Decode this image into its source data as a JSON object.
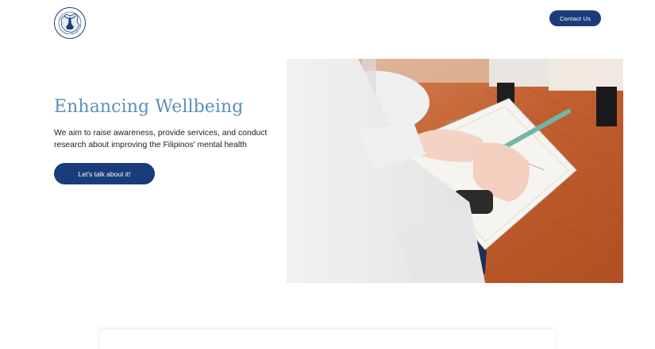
{
  "header": {
    "logo_icon": "organization-seal-logo",
    "contact_label": "Contact Us"
  },
  "hero": {
    "title": "Enhancing Wellbeing",
    "subtitle": "We aim to raise awareness, provide services, and conduct research about improving the Filipinos' mental health",
    "cta_label": "Let's talk about it!",
    "image": "person-writing-in-notebook-photo"
  },
  "colors": {
    "brand_navy": "#1a3c7a",
    "title_blue": "#5b8fbd",
    "text": "#1d1d1f"
  }
}
